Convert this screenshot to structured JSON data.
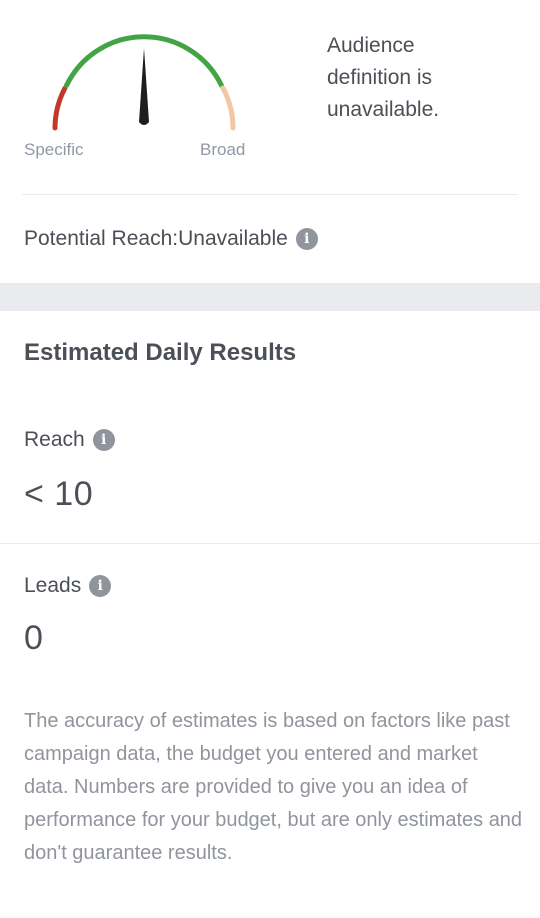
{
  "audience": {
    "gauge_left_label": "Specific",
    "gauge_right_label": "Broad",
    "message": "Audience definition is unavailable.",
    "potential_reach": "Potential Reach:Unavailable",
    "colors": {
      "specific": "#c0392b",
      "good": "#42a445",
      "broad": "#f2c8a0",
      "needle": "#1c1e21"
    }
  },
  "results": {
    "title": "Estimated Daily Results",
    "reach_label": "Reach",
    "reach_value": "< 10",
    "leads_label": "Leads",
    "leads_value": "0",
    "disclaimer": "The accuracy of estimates is based on factors like past campaign data, the budget you entered and market data. Numbers are provided to give you an idea of performance for your budget, but are only estimates and don't guarantee results."
  },
  "icons": {
    "info_glyph": "i"
  }
}
